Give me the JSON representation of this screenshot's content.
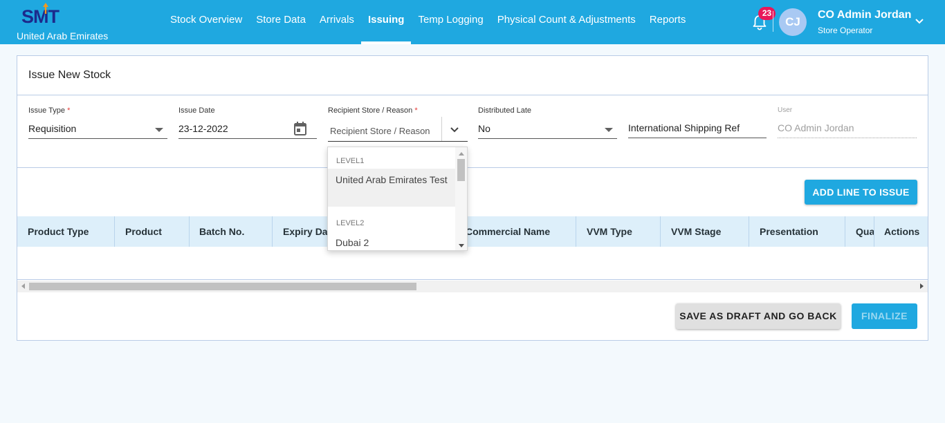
{
  "header": {
    "logo_text": "SMT",
    "country": "United Arab Emirates",
    "nav": [
      {
        "label": "Stock Overview",
        "active": false
      },
      {
        "label": "Store Data",
        "active": false
      },
      {
        "label": "Arrivals",
        "active": false
      },
      {
        "label": "Issuing",
        "active": true
      },
      {
        "label": "Temp Logging",
        "active": false
      },
      {
        "label": "Physical Count & Adjustments",
        "active": false
      },
      {
        "label": "Reports",
        "active": false
      }
    ],
    "notification_count": "23",
    "avatar_initials": "CJ",
    "user_name": "CO Admin Jordan",
    "user_role": "Store Operator"
  },
  "form": {
    "title": "Issue New Stock",
    "issue_type": {
      "label": "Issue Type",
      "required_mark": "*",
      "value": "Requisition"
    },
    "issue_date": {
      "label": "Issue Date",
      "value": "23-12-2022"
    },
    "recipient": {
      "label": "Recipient Store / Reason",
      "required_mark": "*",
      "placeholder": "Recipient Store / Reason"
    },
    "distributed_late": {
      "label": "Distributed Late",
      "value": "No"
    },
    "shipping_ref": {
      "value": "International Shipping Ref"
    },
    "user": {
      "label": "User",
      "value": "CO Admin Jordan"
    }
  },
  "actions": {
    "add_line": "ADD LINE TO ISSUE",
    "save_draft": "SAVE AS DRAFT AND GO BACK",
    "finalize": "FINALIZE"
  },
  "table": {
    "columns": [
      "Product Type",
      "Product",
      "Batch No.",
      "Expiry Date",
      "Commercial Name",
      "VVM Type",
      "VVM Stage",
      "Presentation",
      "Quantity",
      "Actions"
    ]
  },
  "dropdown": {
    "groups": [
      {
        "label": "LEVEL1",
        "options": [
          "United Arab Emirates Test"
        ]
      },
      {
        "label": "LEVEL2",
        "options": [
          "Dubai 2"
        ]
      }
    ]
  },
  "colors": {
    "primary": "#1fa8e0",
    "logo": "#1c2a8c",
    "badge": "#e8185a",
    "table_header": "#ddeffa",
    "page_bg": "#f3f9fd"
  }
}
